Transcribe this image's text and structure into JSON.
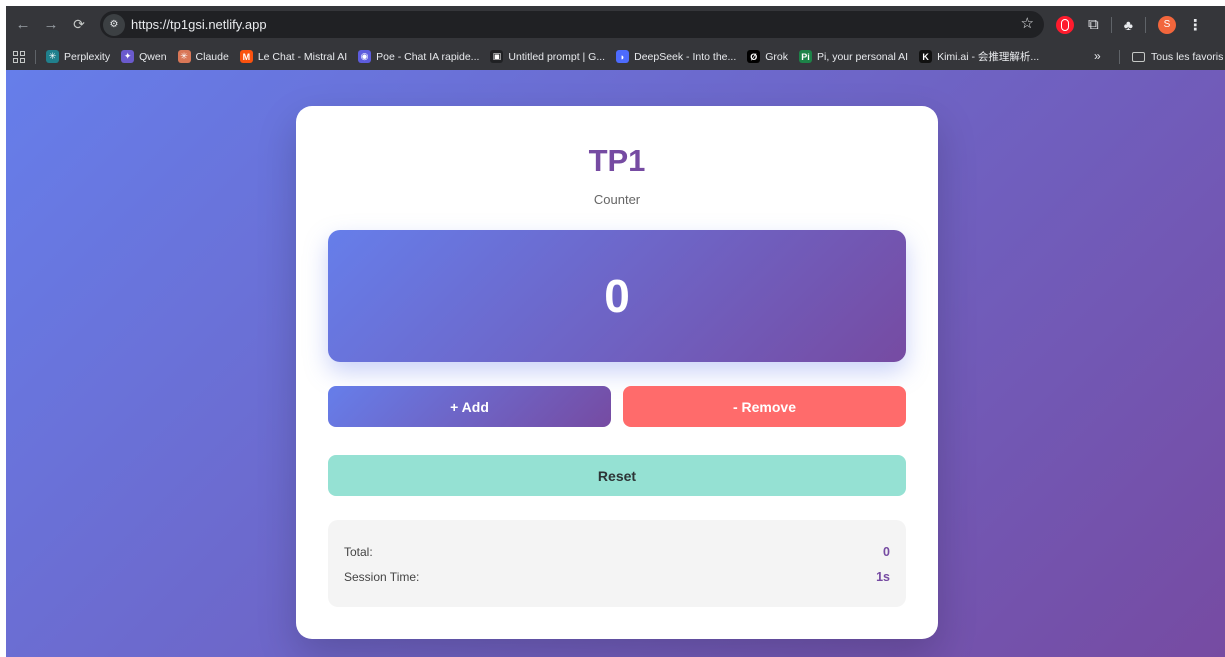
{
  "browser": {
    "url": "https://tp1gsi.netlify.app",
    "avatar_initial": "S",
    "bookmarks": [
      {
        "label": "Perplexity",
        "icon": "perplexity-icon",
        "color": "#20808d",
        "glyph": "✳"
      },
      {
        "label": "Qwen",
        "icon": "qwen-icon",
        "color": "#6a5acd",
        "glyph": "✦"
      },
      {
        "label": "Claude",
        "icon": "claude-icon",
        "color": "#d97757",
        "glyph": "✳"
      },
      {
        "label": "Le Chat - Mistral AI",
        "icon": "mistral-icon",
        "color": "#fa520f",
        "glyph": "M"
      },
      {
        "label": "Poe - Chat IA rapide...",
        "icon": "poe-icon",
        "color": "#5d5cde",
        "glyph": "◉"
      },
      {
        "label": "Untitled prompt | G...",
        "icon": "ai-studio-icon",
        "color": "#202124",
        "glyph": "▣"
      },
      {
        "label": "DeepSeek - Into the...",
        "icon": "deepseek-icon",
        "color": "#4d6bfe",
        "glyph": "◗"
      },
      {
        "label": "Grok",
        "icon": "grok-icon",
        "color": "#000000",
        "glyph": "Ø"
      },
      {
        "label": "Pi, your personal AI",
        "icon": "pi-icon",
        "color": "#1d8348",
        "glyph": "Pi"
      },
      {
        "label": "Kimi.ai - 会推理解析...",
        "icon": "kimi-icon",
        "color": "#111111",
        "glyph": "K"
      }
    ],
    "more_label": "»",
    "folder_label": "Tous les favoris"
  },
  "app": {
    "title": "TP1",
    "subtitle": "Counter",
    "counter_value": "0",
    "add_label": "+ Add",
    "remove_label": "- Remove",
    "reset_label": "Reset",
    "stats": {
      "total_label": "Total:",
      "total_value": "0",
      "session_label": "Session Time:",
      "session_value": "1s"
    }
  },
  "colors": {
    "accent": "#764ba2",
    "gradient_start": "#667eea",
    "remove": "#ff6b6b",
    "reset": "#95e1d3"
  }
}
